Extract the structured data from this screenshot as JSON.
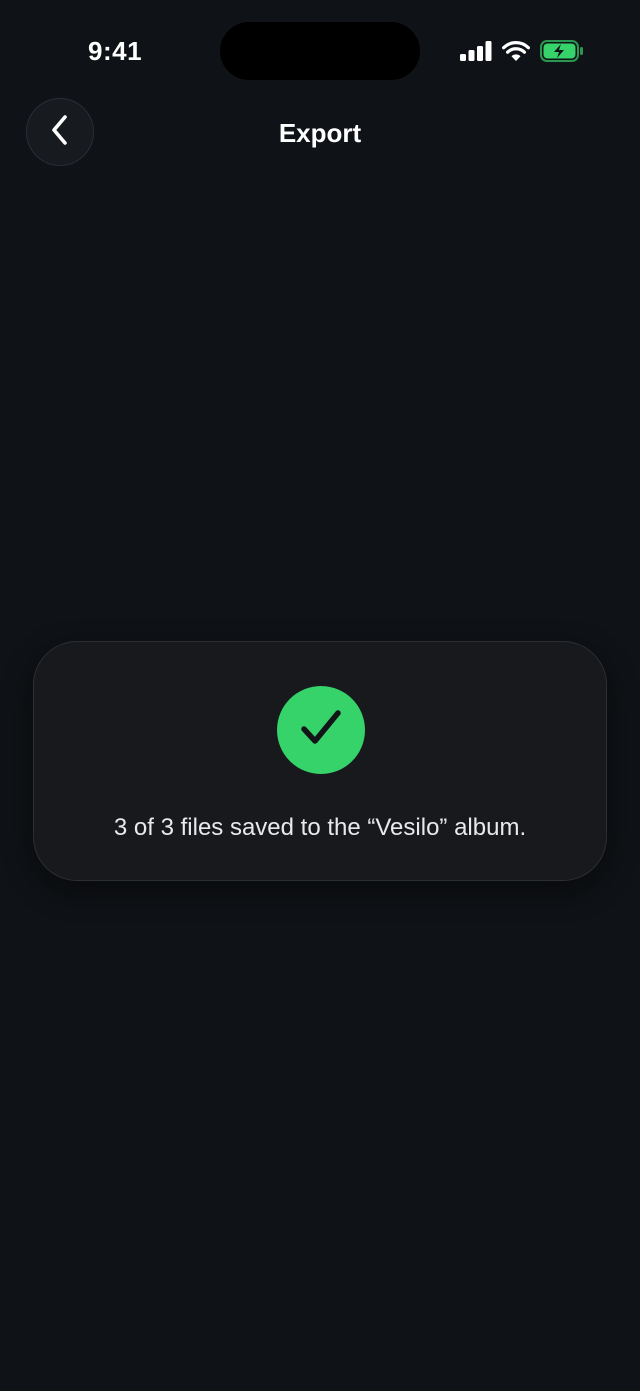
{
  "status_bar": {
    "time": "9:41",
    "icons": [
      "cellular-signal-icon",
      "wifi-icon",
      "battery-charging-icon"
    ],
    "battery_color": "#36d26a"
  },
  "nav": {
    "back_icon": "chevron-left-icon",
    "title": "Export"
  },
  "toast": {
    "icon": "checkmark-icon",
    "icon_bg": "#36d26a",
    "message": "3 of 3 files saved to the “Vesilo” album."
  },
  "colors": {
    "background": "#0f1216",
    "card": "#17191d",
    "accent_green": "#36d26a"
  }
}
